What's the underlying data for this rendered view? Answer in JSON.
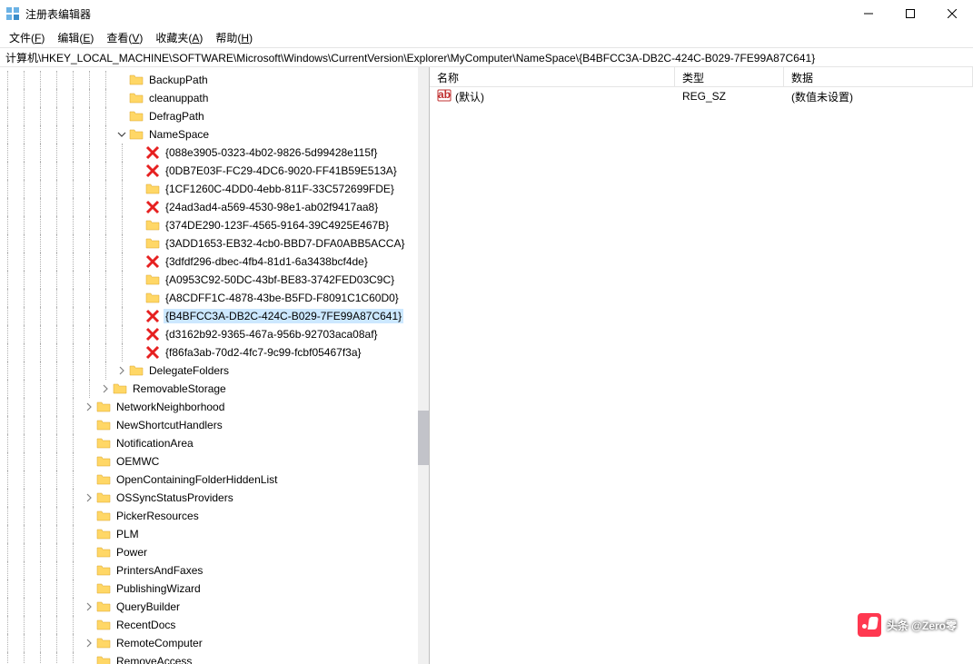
{
  "title": "注册表编辑器",
  "menu": [
    {
      "label": "文件",
      "key": "F"
    },
    {
      "label": "编辑",
      "key": "E"
    },
    {
      "label": "查看",
      "key": "V"
    },
    {
      "label": "收藏夹",
      "key": "A"
    },
    {
      "label": "帮助",
      "key": "H"
    }
  ],
  "address": "计算机\\HKEY_LOCAL_MACHINE\\SOFTWARE\\Microsoft\\Windows\\CurrentVersion\\Explorer\\MyComputer\\NameSpace\\{B4BFCC3A-DB2C-424C-B029-7FE99A87C641}",
  "tree": [
    {
      "d": 8,
      "tw": "",
      "ic": "f",
      "lbl": "BackupPath"
    },
    {
      "d": 8,
      "tw": "",
      "ic": "f",
      "lbl": "cleanuppath"
    },
    {
      "d": 8,
      "tw": "",
      "ic": "f",
      "lbl": "DefragPath"
    },
    {
      "d": 8,
      "tw": "open",
      "ic": "f",
      "lbl": "NameSpace"
    },
    {
      "d": 9,
      "tw": "",
      "ic": "x",
      "lbl": "{088e3905-0323-4b02-9826-5d99428e115f}"
    },
    {
      "d": 9,
      "tw": "",
      "ic": "x",
      "lbl": "{0DB7E03F-FC29-4DC6-9020-FF41B59E513A}"
    },
    {
      "d": 9,
      "tw": "",
      "ic": "f",
      "lbl": "{1CF1260C-4DD0-4ebb-811F-33C572699FDE}"
    },
    {
      "d": 9,
      "tw": "",
      "ic": "x",
      "lbl": "{24ad3ad4-a569-4530-98e1-ab02f9417aa8}"
    },
    {
      "d": 9,
      "tw": "",
      "ic": "f",
      "lbl": "{374DE290-123F-4565-9164-39C4925E467B}"
    },
    {
      "d": 9,
      "tw": "",
      "ic": "f",
      "lbl": "{3ADD1653-EB32-4cb0-BBD7-DFA0ABB5ACCA}"
    },
    {
      "d": 9,
      "tw": "",
      "ic": "x",
      "lbl": "{3dfdf296-dbec-4fb4-81d1-6a3438bcf4de}"
    },
    {
      "d": 9,
      "tw": "",
      "ic": "f",
      "lbl": "{A0953C92-50DC-43bf-BE83-3742FED03C9C}"
    },
    {
      "d": 9,
      "tw": "",
      "ic": "f",
      "lbl": "{A8CDFF1C-4878-43be-B5FD-F8091C1C60D0}"
    },
    {
      "d": 9,
      "tw": "",
      "ic": "x",
      "lbl": "{B4BFCC3A-DB2C-424C-B029-7FE99A87C641}",
      "sel": true
    },
    {
      "d": 9,
      "tw": "",
      "ic": "x",
      "lbl": "{d3162b92-9365-467a-956b-92703aca08af}"
    },
    {
      "d": 9,
      "tw": "",
      "ic": "x",
      "lbl": "{f86fa3ab-70d2-4fc7-9c99-fcbf05467f3a}"
    },
    {
      "d": 8,
      "tw": "closed",
      "ic": "f",
      "lbl": "DelegateFolders"
    },
    {
      "d": 7,
      "tw": "closed",
      "ic": "f",
      "lbl": "RemovableStorage"
    },
    {
      "d": 6,
      "tw": "closed",
      "ic": "f",
      "lbl": "NetworkNeighborhood"
    },
    {
      "d": 6,
      "tw": "",
      "ic": "f",
      "lbl": "NewShortcutHandlers"
    },
    {
      "d": 6,
      "tw": "",
      "ic": "f",
      "lbl": "NotificationArea"
    },
    {
      "d": 6,
      "tw": "",
      "ic": "f",
      "lbl": "OEMWC"
    },
    {
      "d": 6,
      "tw": "",
      "ic": "f",
      "lbl": "OpenContainingFolderHiddenList"
    },
    {
      "d": 6,
      "tw": "closed",
      "ic": "f",
      "lbl": "OSSyncStatusProviders"
    },
    {
      "d": 6,
      "tw": "",
      "ic": "f",
      "lbl": "PickerResources"
    },
    {
      "d": 6,
      "tw": "",
      "ic": "f",
      "lbl": "PLM"
    },
    {
      "d": 6,
      "tw": "",
      "ic": "f",
      "lbl": "Power"
    },
    {
      "d": 6,
      "tw": "",
      "ic": "f",
      "lbl": "PrintersAndFaxes"
    },
    {
      "d": 6,
      "tw": "",
      "ic": "f",
      "lbl": "PublishingWizard"
    },
    {
      "d": 6,
      "tw": "closed",
      "ic": "f",
      "lbl": "QueryBuilder"
    },
    {
      "d": 6,
      "tw": "",
      "ic": "f",
      "lbl": "RecentDocs"
    },
    {
      "d": 6,
      "tw": "closed",
      "ic": "f",
      "lbl": "RemoteComputer"
    },
    {
      "d": 6,
      "tw": "",
      "ic": "f",
      "lbl": "RemoveAccess"
    }
  ],
  "columns": {
    "name": "名称",
    "type": "类型",
    "data": "数据"
  },
  "values": [
    {
      "name": "(默认)",
      "type": "REG_SZ",
      "data": "(数值未设置)"
    }
  ],
  "watermark": "头条 @Zero零"
}
